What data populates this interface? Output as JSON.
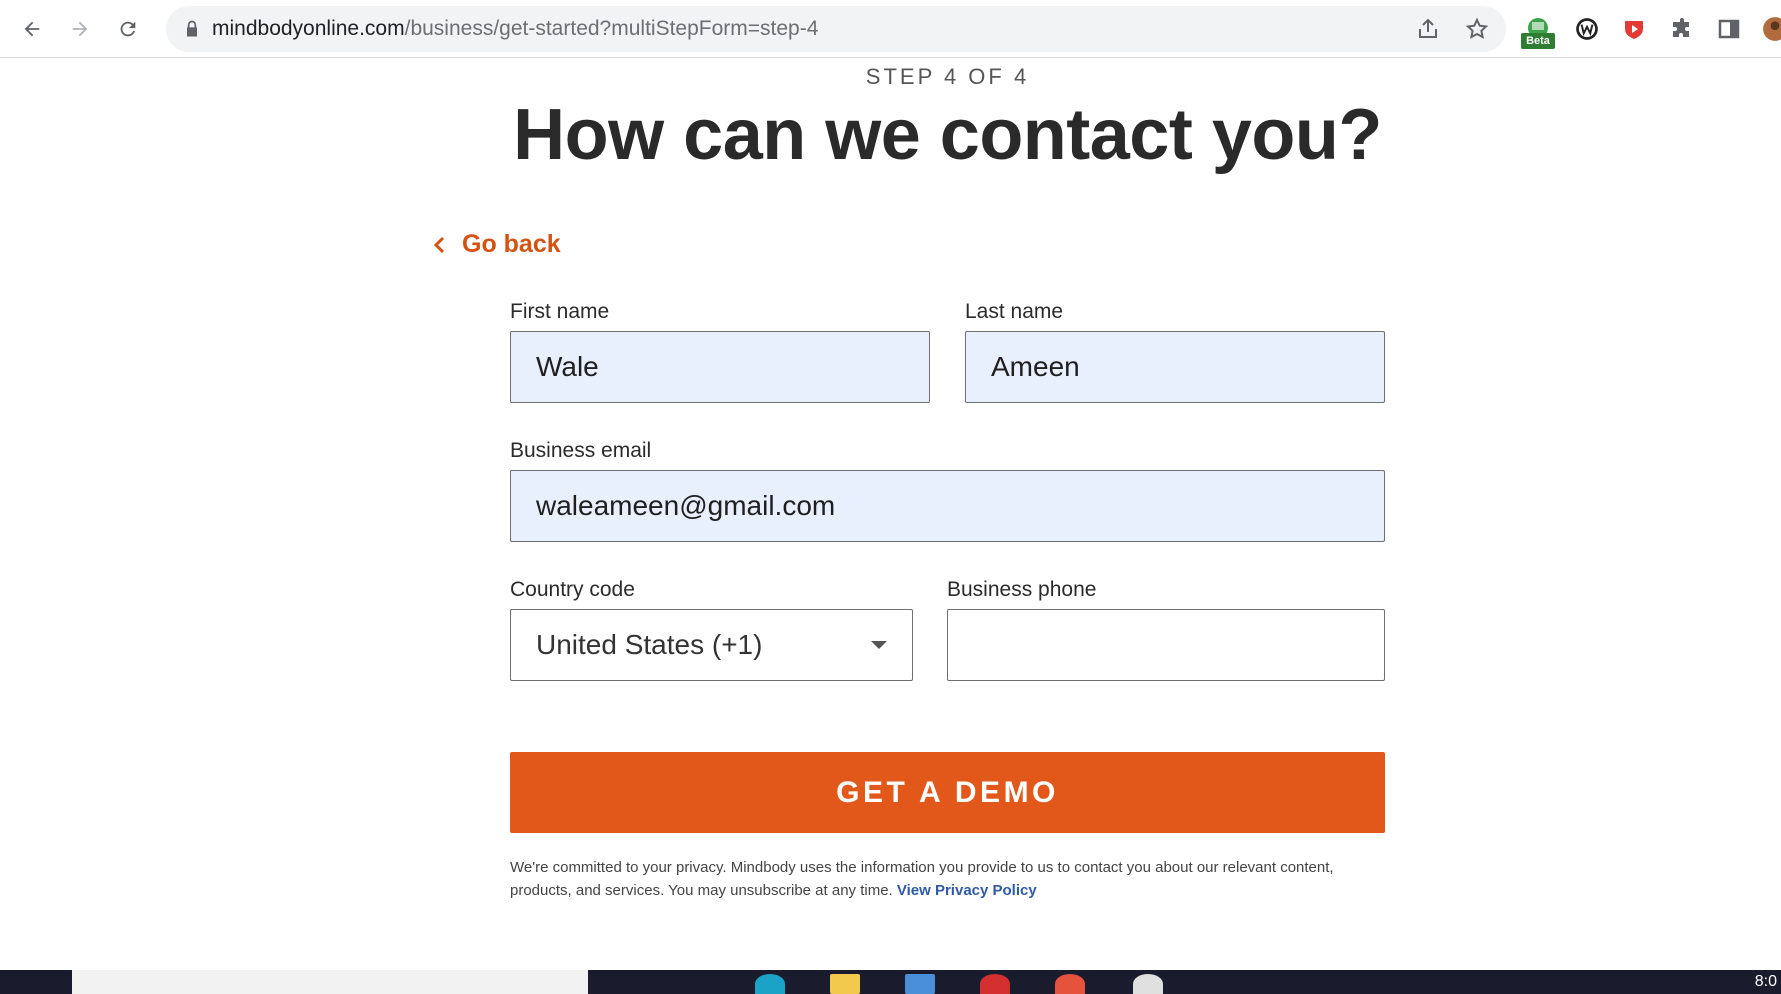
{
  "browser": {
    "url_host": "mindbodyonline.com",
    "url_path": "/business/get-started?multiStepForm=step-4",
    "beta_label": "Beta"
  },
  "page": {
    "step_label": "STEP 4 OF 4",
    "headline": "How can we contact you?",
    "go_back_label": "Go back"
  },
  "form": {
    "first_name": {
      "label": "First name",
      "value": "Wale"
    },
    "last_name": {
      "label": "Last name",
      "value": "Ameen"
    },
    "business_email": {
      "label": "Business email",
      "value": "waleameen@gmail.com"
    },
    "country_code": {
      "label": "Country code",
      "value": "United States (+1)"
    },
    "business_phone": {
      "label": "Business phone",
      "value": ""
    },
    "submit_label": "GET A DEMO"
  },
  "privacy": {
    "text": "We're committed to your privacy. Mindbody uses the information you provide to us to contact you about our relevant content, products, and services. You may unsubscribe at any time.",
    "link_label": "View Privacy Policy"
  },
  "taskbar": {
    "clock": "8:0"
  },
  "colors": {
    "accent": "#e2581a",
    "link": "#2f5aa8",
    "filled_input": "#e8effd"
  }
}
